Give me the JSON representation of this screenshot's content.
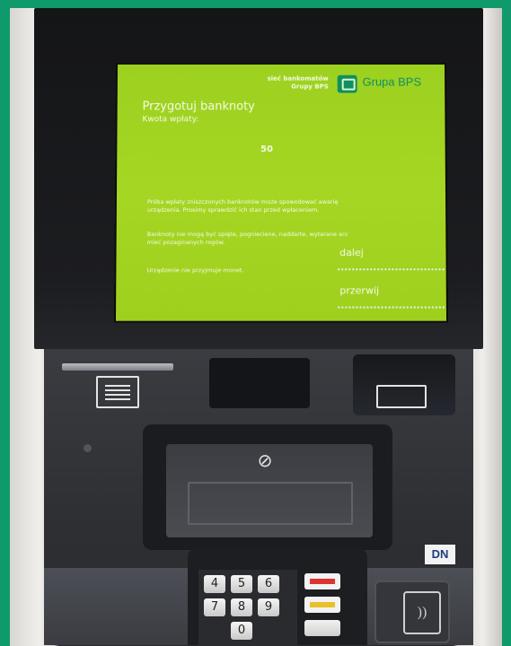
{
  "screen": {
    "network_label_line1": "sieć bankomatów",
    "network_label_line2": "Grupy BPS",
    "logo_name": "Grupa BPS",
    "title": "Przygotuj banknoty",
    "subtitle": "Kwota wpłaty:",
    "amount": "50",
    "info_1": "Próba wpłaty zniszczonych banknotów może spowodować awarię urządzenia. Prosimy sprawdzić ich stan przed wpłaceniem.",
    "info_2": "Banknoty nie mogą być spięte, pognieciene, naddarte, wytarane ani mieć pozaginanych rogów.",
    "info_3": "Urządzenie nie przyjmuje monet.",
    "next_button": "dalej",
    "cancel_button": "przerwij"
  },
  "atm": {
    "manufacturer_logo": "DN",
    "keypad_keys": [
      "4",
      "5",
      "6",
      "7",
      "8",
      "9",
      "0"
    ]
  },
  "colors": {
    "frame": "#0e9a6b",
    "screen_bg": "#a5d624",
    "screen_text": "#f4fbe6",
    "brand": "#0e8f63"
  }
}
